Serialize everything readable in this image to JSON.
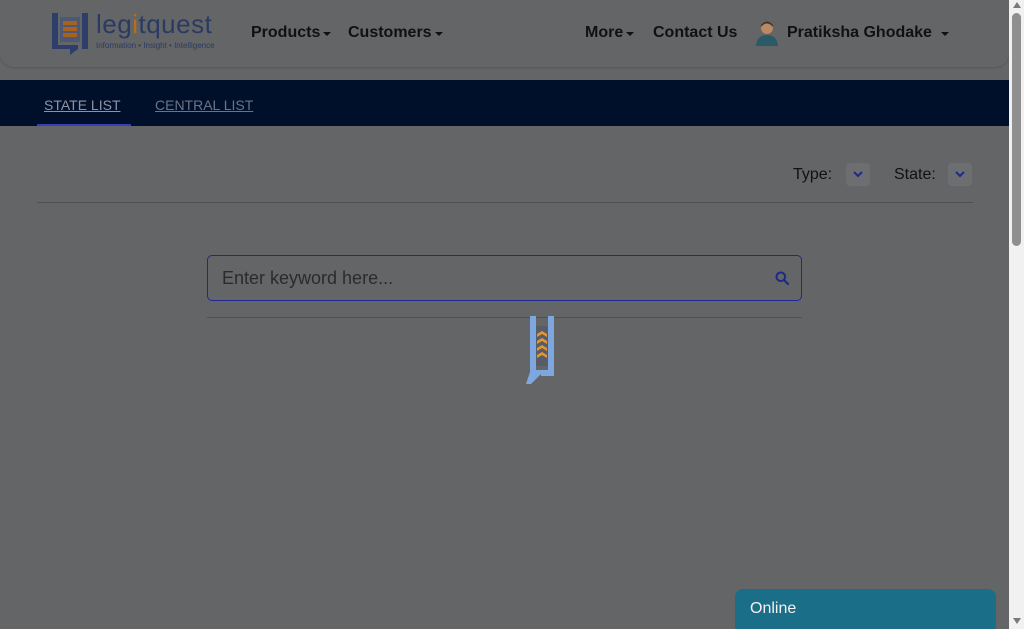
{
  "header": {
    "logo": {
      "name": "legitquest",
      "word_prefix": "leg",
      "word_highlight": "i",
      "word_suffix": "tquest",
      "tagline": "Information • Insight • Intelligence"
    },
    "nav": {
      "products": "Products",
      "customers": "Customers",
      "more": "More",
      "contact": "Contact Us"
    },
    "user": {
      "name": "Pratiksha Ghodake",
      "icon": "user-avatar-icon"
    }
  },
  "tabs": [
    {
      "label": "STATE LIST",
      "active": true
    },
    {
      "label": "CENTRAL LIST",
      "active": false
    }
  ],
  "filters": {
    "type_label": "Type:",
    "type_value": "",
    "state_label": "State:",
    "state_value": ""
  },
  "search": {
    "placeholder": "Enter keyword here...",
    "value": "",
    "icon": "search-icon"
  },
  "loader": {
    "icon": "legitquest-loading-icon"
  },
  "chat": {
    "label": "Online"
  },
  "colors": {
    "overlay_bg": "#646566",
    "tabbar_bg": "#000f2a",
    "accent": "#202694",
    "chat_bg": "#1b6e88",
    "brand_orange": "#b76d1c"
  }
}
